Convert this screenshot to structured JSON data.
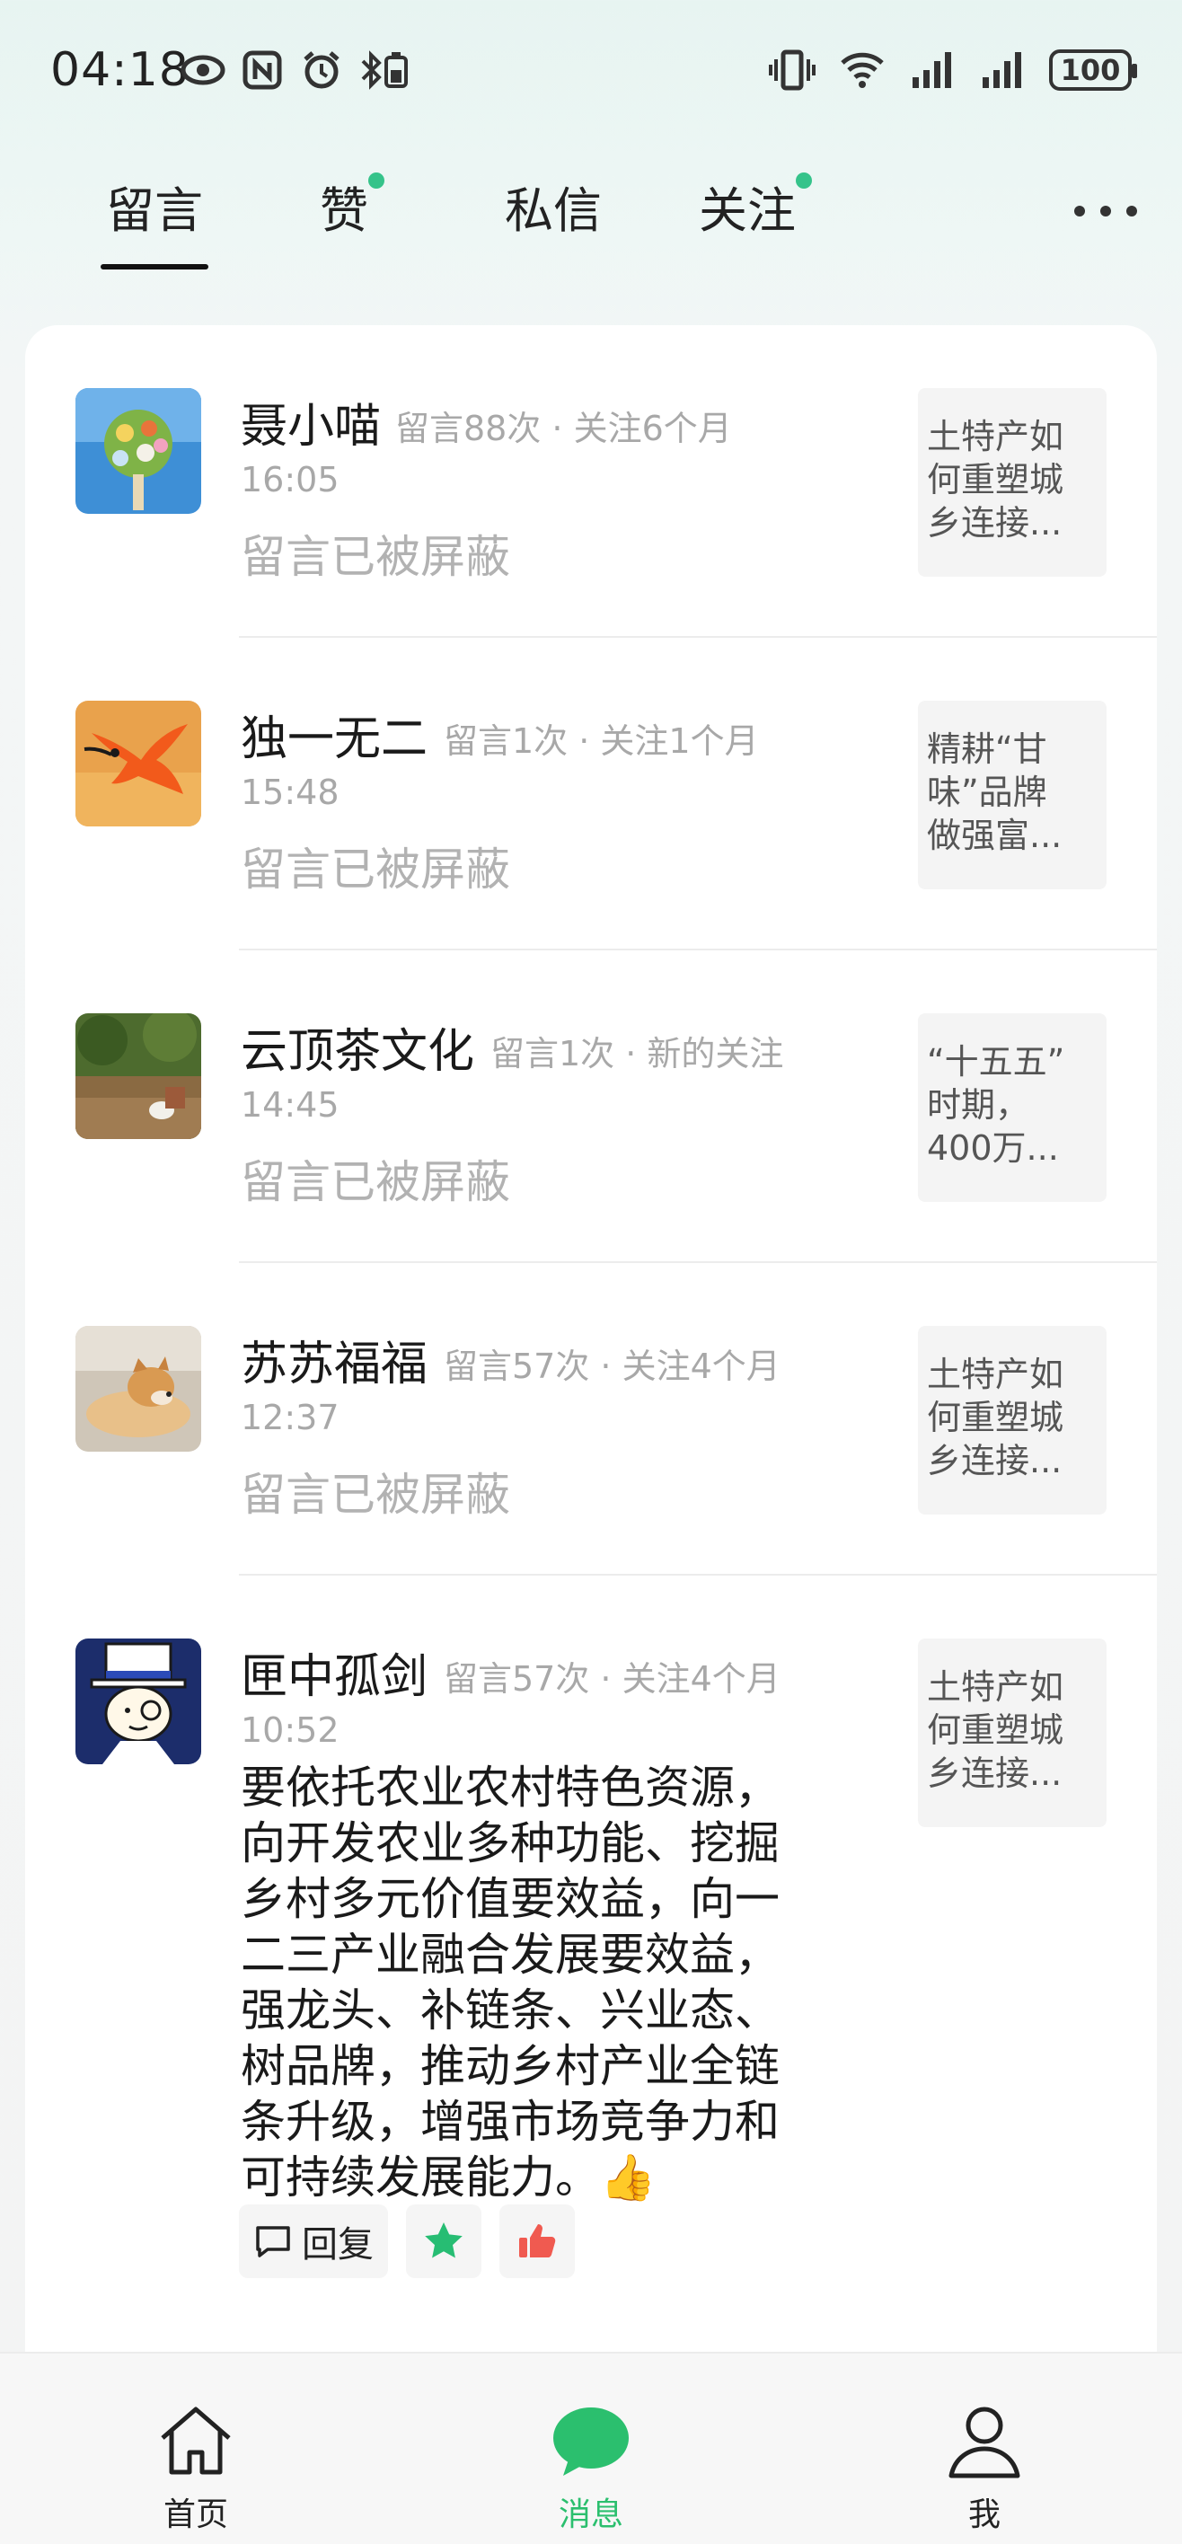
{
  "status_bar": {
    "time": "04:18",
    "battery": "100",
    "icons": [
      "eye-icon",
      "nfc-icon",
      "alarm-icon",
      "bluetooth-battery-icon",
      "vibrate-icon",
      "wifi-icon",
      "signal-icon",
      "signal-icon",
      "battery-icon"
    ]
  },
  "tabs": [
    {
      "label": "留言",
      "active": true,
      "dot": false
    },
    {
      "label": "赞",
      "active": false,
      "dot": true
    },
    {
      "label": "私信",
      "active": false,
      "dot": false
    },
    {
      "label": "关注",
      "active": false,
      "dot": true
    }
  ],
  "messages": [
    {
      "name": "聂小喵",
      "meta": "留言88次 · 关注6个月",
      "time": "16:05",
      "text": "留言已被屏蔽",
      "blocked": true,
      "article": [
        "土特产如",
        "何重塑城",
        "乡连接..."
      ],
      "avatar_icon": "flower-bouquet-avatar"
    },
    {
      "name": "独一无二",
      "meta": "留言1次 · 关注1个月",
      "time": "15:48",
      "text": "留言已被屏蔽",
      "blocked": true,
      "article": [
        "精耕“甘",
        "味”品牌",
        "做强富..."
      ],
      "avatar_icon": "red-bird-avatar"
    },
    {
      "name": "云顶茶文化",
      "meta": "留言1次 · 新的关注",
      "time": "14:45",
      "text": "留言已被屏蔽",
      "blocked": true,
      "article": [
        "“十五五”",
        "时期，",
        "400万..."
      ],
      "avatar_icon": "tea-garden-avatar"
    },
    {
      "name": "苏苏福福",
      "meta": "留言57次 · 关注4个月",
      "time": "12:37",
      "text": "留言已被屏蔽",
      "blocked": true,
      "article": [
        "土特产如",
        "何重塑城",
        "乡连接..."
      ],
      "avatar_icon": "shiba-dog-avatar"
    },
    {
      "name": "匣中孤剑",
      "meta": "留言57次 · 关注4个月",
      "time": "10:52",
      "text_lines": [
        "要依托农业农村特色资源，",
        "向开发农业多种功能、挖掘",
        "乡村多元价值要效益，向一",
        "二三产业融合发展要效益，",
        "强龙头、补链条、兴业态、",
        "树品牌，推动乡村产业全链",
        "条升级，增强市场竞争力和",
        "可持续发展能力。👍"
      ],
      "blocked": false,
      "article": [
        "土特产如",
        "何重塑城",
        "乡连接..."
      ],
      "avatar_icon": "cartoon-detective-avatar"
    }
  ],
  "actions": {
    "reply_label": "回复"
  },
  "bottom_nav": [
    {
      "label": "首页",
      "icon": "home-icon",
      "active": false
    },
    {
      "label": "消息",
      "icon": "chat-bubble-icon",
      "active": true
    },
    {
      "label": "我",
      "icon": "profile-icon",
      "active": false
    }
  ],
  "colors": {
    "accent": "#2bbf6e",
    "dot": "#35c38a",
    "thumb_up": "#f05a50"
  }
}
